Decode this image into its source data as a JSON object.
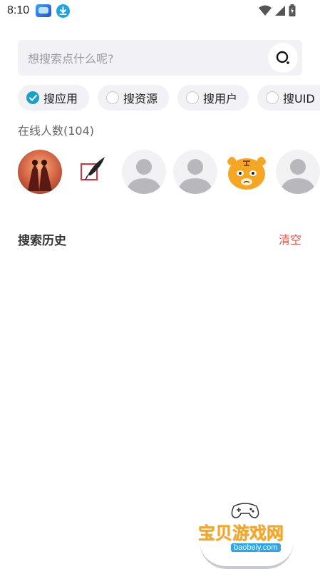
{
  "status_bar": {
    "time": "8:10",
    "icons": [
      "app-icon",
      "download-icon",
      "wifi-icon",
      "signal-icon",
      "battery-icon"
    ]
  },
  "search": {
    "placeholder": "想搜索点什么呢?",
    "value": ""
  },
  "filters": [
    {
      "label": "搜应用",
      "checked": true
    },
    {
      "label": "搜资源",
      "checked": false
    },
    {
      "label": "搜用户",
      "checked": false
    },
    {
      "label": "搜UID",
      "checked": false
    }
  ],
  "online": {
    "title": "在线人数(104)",
    "avatars": [
      "avatar-red-scene",
      "avatar-feather-pen",
      "avatar-default",
      "avatar-default",
      "avatar-tiger",
      "avatar-default"
    ]
  },
  "history": {
    "title": "搜索历史",
    "clear_label": "清空"
  },
  "watermark": {
    "text": "宝贝游戏网",
    "url": "baobeiy.com"
  },
  "colors": {
    "accent": "#1ba0c8",
    "clear": "#e05a50",
    "chip_bg": "#f1f1f6"
  }
}
